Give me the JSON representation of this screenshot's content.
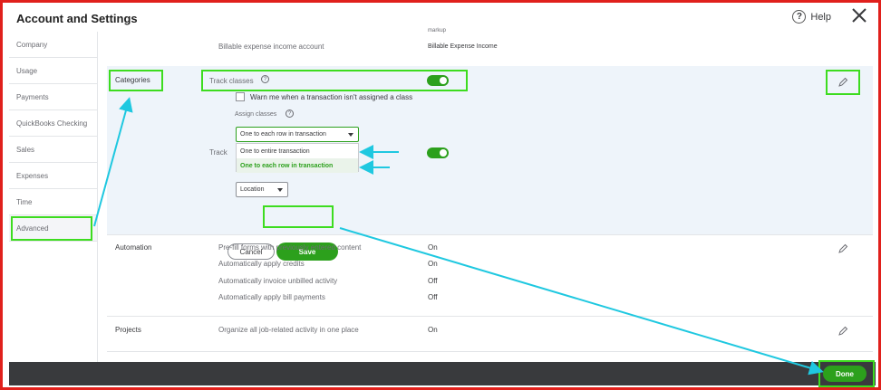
{
  "header": {
    "title": "Account and Settings",
    "help_label": "Help"
  },
  "sidebar": {
    "items": [
      {
        "label": "Company"
      },
      {
        "label": "Usage"
      },
      {
        "label": "Payments"
      },
      {
        "label": "QuickBooks Checking"
      },
      {
        "label": "Sales"
      },
      {
        "label": "Expenses"
      },
      {
        "label": "Time"
      },
      {
        "label": "Advanced"
      }
    ],
    "active": "Advanced"
  },
  "top_section": {
    "partial_value": "markup",
    "billable_label": "Billable expense income account",
    "billable_value": "Billable Expense Income"
  },
  "categories": {
    "heading": "Categories",
    "track_classes_label": "Track classes",
    "track_classes_on": true,
    "warn_label": "Warn me when a transaction isn't assigned a class",
    "assign_classes_label": "Assign classes",
    "assign_classes_value": "One to each row in transaction",
    "dropdown_options": [
      "One to entire transaction",
      "One to each row in transaction"
    ],
    "dropdown_selected": "One to each row in transaction",
    "track_locations_partial": "Track",
    "track_locations_on": true,
    "location_select_value": "Location",
    "cancel_label": "Cancel",
    "save_label": "Save"
  },
  "automation": {
    "heading": "Automation",
    "rows": [
      {
        "label": "Pre-fill forms with previously entered content",
        "value": "On"
      },
      {
        "label": "Automatically apply credits",
        "value": "On"
      },
      {
        "label": "Automatically invoice unbilled activity",
        "value": "Off"
      },
      {
        "label": "Automatically apply bill payments",
        "value": "Off"
      }
    ]
  },
  "projects": {
    "heading": "Projects",
    "label": "Organize all job-related activity in one place",
    "value": "On"
  },
  "footer": {
    "done_label": "Done"
  },
  "colors": {
    "frame_border": "#e0201c",
    "highlight_box": "#3ddc1f",
    "arrow": "#1fc8e0",
    "primary_green": "#2ca01c",
    "footer_bg": "#393a3d"
  },
  "icons": [
    "help-icon",
    "close-icon",
    "pencil-icon",
    "caret-down-icon"
  ]
}
